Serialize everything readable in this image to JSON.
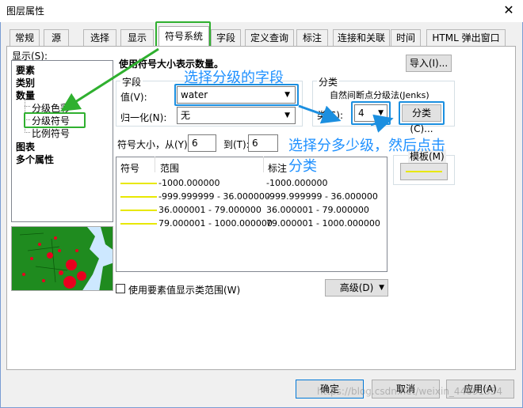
{
  "window": {
    "title": "图层属性"
  },
  "tabs": [
    "常规",
    "源",
    "选择",
    "显示",
    "符号系统",
    "字段",
    "定义查询",
    "标注",
    "连接和关联",
    "时间",
    "HTML 弹出窗口"
  ],
  "show_label": "显示(S):",
  "tree": {
    "features": "要素",
    "categories": "类别",
    "quantities": "数量",
    "graduated_colors": "分级色彩",
    "graduated_symbols": "分级符号",
    "proportional_symbols": "比例符号",
    "charts": "图表",
    "multiple_attributes": "多个属性"
  },
  "heading": "使用符号大小表示数量。",
  "import_button": "导入(I)...",
  "fields": {
    "legend": "字段",
    "value_label": "值(V):",
    "value": "water",
    "normalize_label": "归一化(N):",
    "normalize_value": "无"
  },
  "classification": {
    "legend": "分类",
    "method": "自然间断点分级法(Jenks)",
    "classes_label": "类(S):",
    "classes_value": "4",
    "classify_button": "分类(C)..."
  },
  "symbol_size": {
    "from_label": "符号大小，从(Y)",
    "from": "6",
    "to_label": "到(T):",
    "to": "6"
  },
  "template_label": "模板(M)",
  "table": {
    "headers": [
      "符号",
      "范围",
      "标注"
    ],
    "rows": [
      {
        "range": "-1000.000000",
        "label": "-1000.000000"
      },
      {
        "range": "-999.999999 - 36.000000",
        "label": "-999.999999 - 36.000000"
      },
      {
        "range": "36.000001 - 79.000000",
        "label": "36.000001 - 79.000000"
      },
      {
        "range": "79.000001 - 1000.000000",
        "label": "79.000001 - 1000.000000"
      }
    ]
  },
  "checkbox_label": "使用要素值显示类范围(W)",
  "advanced_button": "高级(D)",
  "annotations": {
    "select_field": "选择分级的字段",
    "select_count_line1": "选择分多少级，然后点击",
    "select_count_line2": "分类"
  },
  "footer": {
    "ok": "确定",
    "cancel": "取消",
    "apply": "应用(A)"
  },
  "watermark": "https://blog.csdn.net/weixin_44091354",
  "colors": {
    "annotation_blue": "#1e90ff",
    "highlight_green": "#2fb02f",
    "symbol_yellow": "#e8e800",
    "map_red": "#e8001e",
    "map_green": "#1f8b1f"
  }
}
